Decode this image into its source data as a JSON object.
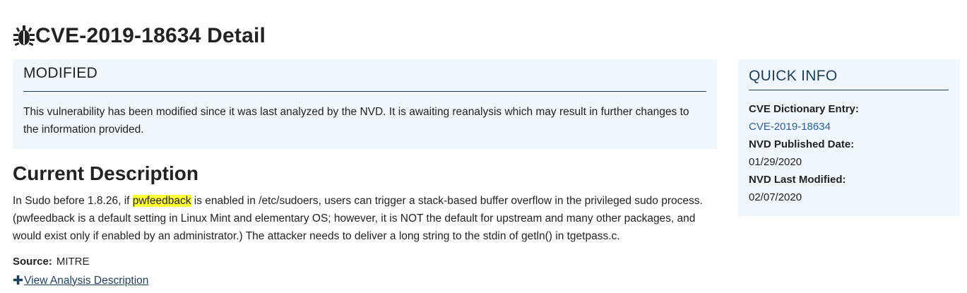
{
  "page": {
    "title": "CVE-2019-18634 Detail",
    "title_icon": "bug-icon"
  },
  "notice": {
    "heading": "MODIFIED",
    "body": "This vulnerability has been modified since it was last analyzed by the NVD. It is awaiting reanalysis which may result in further changes to the information provided."
  },
  "current_description": {
    "heading": "Current Description",
    "text_before": "In Sudo before 1.8.26, if ",
    "highlight": "pwfeedback",
    "text_after": " is enabled in /etc/sudoers, users can trigger a stack-based buffer overflow in the privileged sudo process. (pwfeedback is a default setting in Linux Mint and elementary OS; however, it is NOT the default for upstream and many other packages, and would exist only if enabled by an administrator.) The attacker needs to deliver a long string to the stdin of getln() in tgetpass.c.",
    "source_label": "Source:",
    "source_value": "MITRE",
    "view_link": "View Analysis Description",
    "view_link_icon": "plus-icon"
  },
  "quick_info": {
    "heading": "QUICK INFO",
    "cve_entry_label": "CVE Dictionary Entry:",
    "cve_entry_value": "CVE-2019-18634",
    "published_label": "NVD Published Date:",
    "published_value": "01/29/2020",
    "modified_label": "NVD Last Modified:",
    "modified_value": "02/07/2020"
  },
  "colors": {
    "panel_bg": "#eff6fc",
    "rule": "#1c3f5f",
    "link": "#2a5fa0",
    "highlight": "#ffff33"
  }
}
